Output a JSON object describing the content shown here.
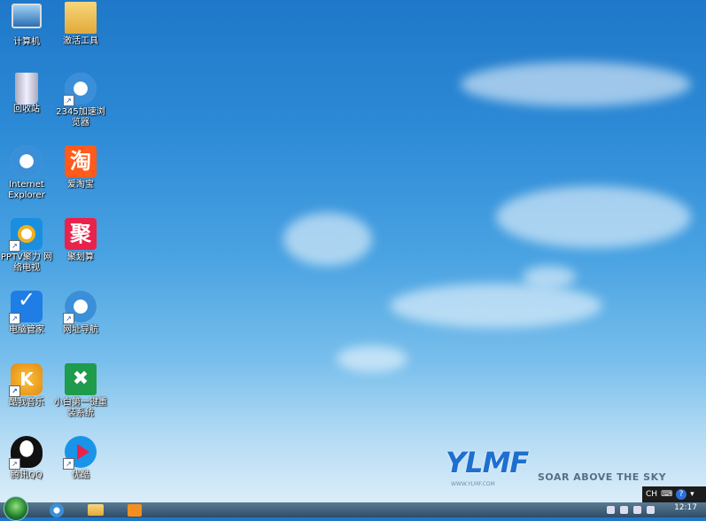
{
  "desktop": {
    "icons": [
      {
        "label": "计算机"
      },
      {
        "label": "激活工具"
      },
      {
        "label": "回收站"
      },
      {
        "label": "2345加速浏览器"
      },
      {
        "label": "Internet Explorer"
      },
      {
        "label": "爱淘宝"
      },
      {
        "label": "PPTV聚力 网络电视"
      },
      {
        "label": "聚划算"
      },
      {
        "label": "电脑管家"
      },
      {
        "label": "网址导航"
      },
      {
        "label": "酷我音乐"
      },
      {
        "label": "小白第一键重装系统"
      },
      {
        "label": "腾讯QQ"
      },
      {
        "label": "优酷"
      }
    ],
    "glyphs": {
      "taobao": "淘",
      "juhuasuan": "聚",
      "kugou": "K"
    }
  },
  "logo": {
    "brand": "YLMF",
    "url": "WWW.YLMF.COM",
    "tagline": "SOAR ABOVE THE SKY"
  },
  "langbar": {
    "lang": "CH",
    "help": "?"
  },
  "taskbar": {
    "clock": "12:17"
  }
}
